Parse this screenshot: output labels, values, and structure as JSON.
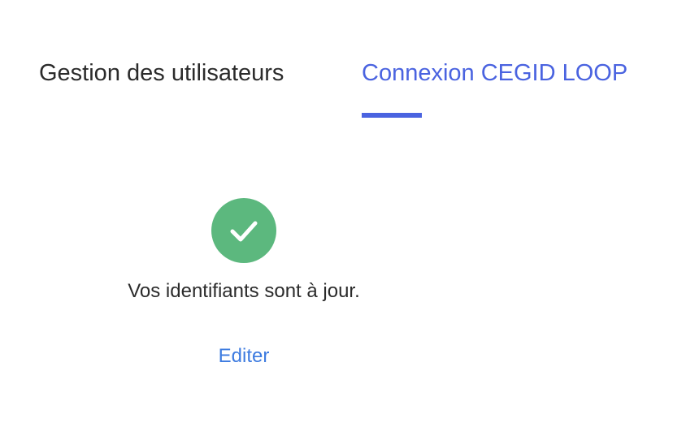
{
  "tabs": {
    "users_label": "Gestion des utilisateurs",
    "loop_label": "Connexion CEGID LOOP",
    "active": "loop"
  },
  "status": {
    "icon": "check-circle-icon",
    "message": "Vos identifiants sont à jour.",
    "edit_label": "Editer"
  },
  "colors": {
    "accent": "#4a63e0",
    "link": "#3d7be0",
    "success": "#5cb87e",
    "text": "#2b2b2b"
  }
}
